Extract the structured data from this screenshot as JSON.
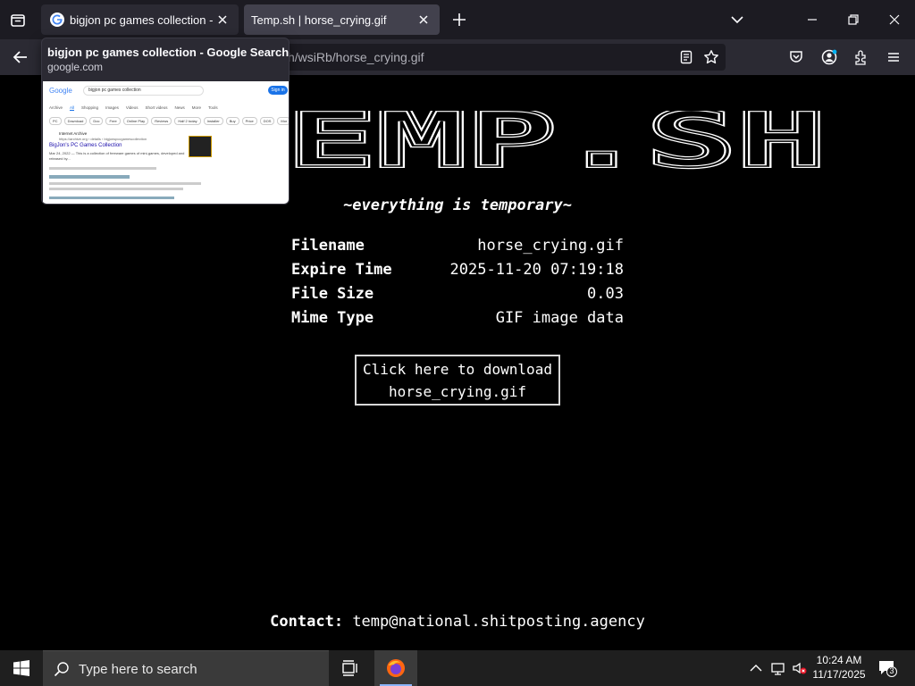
{
  "browser": {
    "tabs": [
      {
        "title": "bigjon pc games collection - G",
        "active": false
      },
      {
        "title": "Temp.sh | horse_crying.gif",
        "active": true
      }
    ],
    "url_text": "h/wsiRb/horse_crying.gif"
  },
  "tab_preview": {
    "title": "bigjon pc games collection - Google Search",
    "domain": "google.com",
    "thumb": {
      "logo": "Google",
      "query": "bigjon pc games collection",
      "signin": "Sign in",
      "nav": [
        "Archive",
        "All",
        "Shopping",
        "Images",
        "Videos",
        "Short videos",
        "News",
        "More",
        "Tools"
      ],
      "chips": [
        "PC",
        "Download",
        "Doc",
        "Free",
        "Online Play",
        "Reviews",
        "Half 2 today",
        "Installer",
        "Buy",
        "Price",
        "DOS",
        "Mor"
      ],
      "r1_source": "Internet Archive",
      "r1_url": "https://archive.org › details › bigjonspccgamescollection",
      "r1_title": "BigJon's PC Games Collection",
      "r1_snip1": "Mar 24, 2022 — This is a collection of freeware games of mini-games, developed and",
      "r1_snip2": "released by..."
    }
  },
  "page": {
    "logo_text": "TEMP.SH",
    "tagline": "~everything is temporary~",
    "info": [
      {
        "label": "Filename",
        "value": "horse_crying.gif"
      },
      {
        "label": "Expire Time",
        "value": "2025-11-20 07:19:18"
      },
      {
        "label": "File Size",
        "value": "0.03"
      },
      {
        "label": "Mime Type",
        "value": "GIF image data"
      }
    ],
    "download_line1": "Click here to download",
    "download_line2": "horse_crying.gif",
    "contact_label": "Contact:",
    "contact_value": "temp@national.shitposting.agency"
  },
  "taskbar": {
    "search_placeholder": "Type here to search",
    "time": "10:24 AM",
    "date": "11/17/2025",
    "notification_count": "3"
  }
}
